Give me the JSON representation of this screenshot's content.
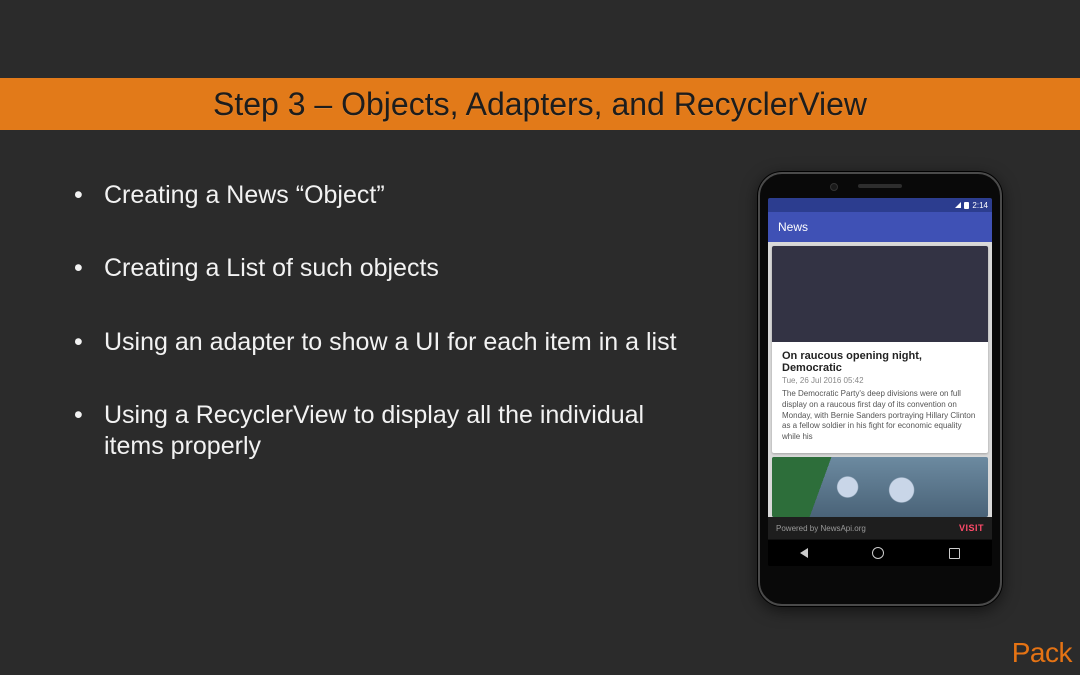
{
  "title": "Step 3 – Objects, Adapters, and RecyclerView",
  "bullets": [
    "Creating a News “Object”",
    "Creating a List of such objects",
    "Using an adapter to show a UI for each item in a list",
    "Using a RecyclerView to display all the individual items properly"
  ],
  "phone": {
    "status_time": "2:14",
    "app_title": "News",
    "card": {
      "headline": "On raucous opening night, Democratic",
      "date": "Tue, 26 Jul 2016 05:42",
      "body": "The Democratic Party's deep divisions were on full display on a raucous first day of its convention on Monday, with Bernie Sanders portraying Hillary Clinton as a fellow soldier in his fight for economic equality while his"
    },
    "footer_left": "Powered by NewsApi.org",
    "footer_right": "VISIT"
  },
  "brand": "Pack"
}
